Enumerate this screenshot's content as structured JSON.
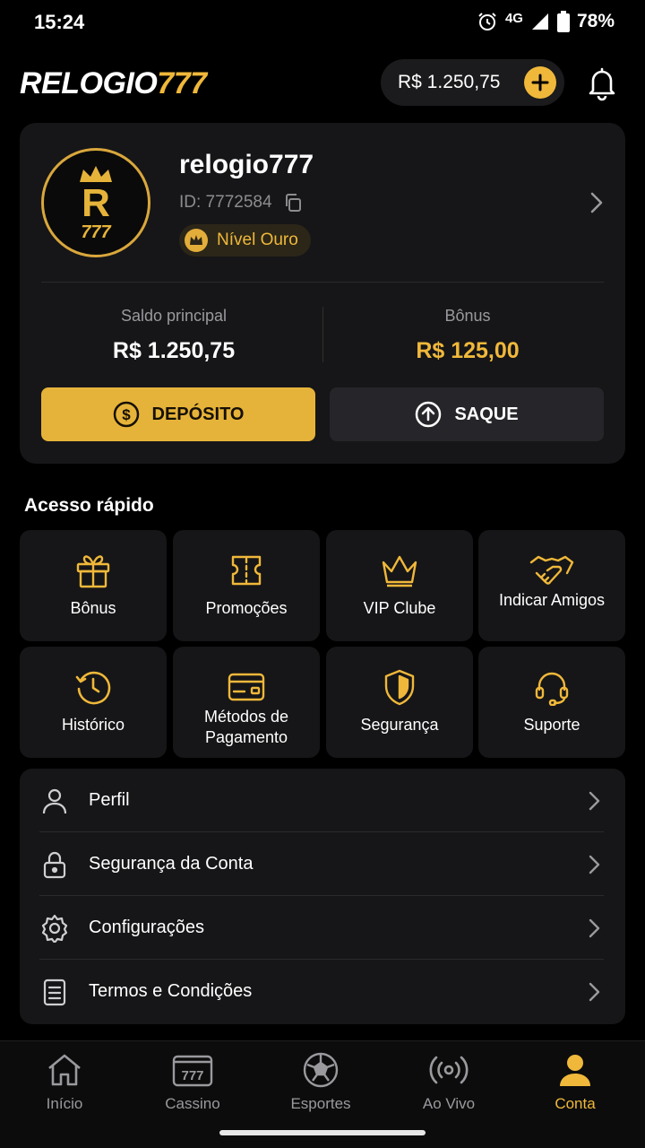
{
  "status_bar": {
    "time": "15:24",
    "network": "4G",
    "battery": "78%"
  },
  "header": {
    "logo_white": "RELOGIO",
    "logo_gold": "777",
    "balance": "R$ 1.250,75"
  },
  "profile": {
    "username": "relogio777",
    "user_id": "ID: 7772584",
    "level": "Nível Ouro",
    "avatar_letter": "R",
    "avatar_number": "777"
  },
  "wallet": {
    "main_label": "Saldo principal",
    "main_value": "R$ 1.250,75",
    "bonus_label": "Bônus",
    "bonus_value": "R$ 125,00",
    "deposit_label": "DEPÓSITO",
    "withdraw_label": "SAQUE"
  },
  "quick_access": {
    "title": "Acesso rápido",
    "tiles": [
      {
        "label": "Bônus",
        "icon": "gift-icon"
      },
      {
        "label": "Promoções",
        "icon": "ticket-icon"
      },
      {
        "label": "VIP Clube",
        "icon": "crown-icon"
      },
      {
        "label": "Indicar Amigos",
        "icon": "handshake-icon"
      },
      {
        "label": "Histórico",
        "icon": "history-icon"
      },
      {
        "label": "Métodos de Pagamento",
        "icon": "card-icon"
      },
      {
        "label": "Segurança",
        "icon": "shield-icon"
      },
      {
        "label": "Suporte",
        "icon": "headset-icon"
      }
    ]
  },
  "menu": [
    {
      "label": "Perfil",
      "icon": "user-icon"
    },
    {
      "label": "Segurança da Conta",
      "icon": "lock-icon"
    },
    {
      "label": "Configurações",
      "icon": "gear-icon"
    },
    {
      "label": "Termos e Condições",
      "icon": "document-icon"
    }
  ],
  "bottom_nav": [
    {
      "label": "Início",
      "icon": "home-icon"
    },
    {
      "label": "Cassino",
      "icon": "slot-icon"
    },
    {
      "label": "Esportes",
      "icon": "soccer-ball-icon"
    },
    {
      "label": "Ao Vivo",
      "icon": "live-icon"
    },
    {
      "label": "Conta",
      "icon": "account-icon",
      "active": true
    }
  ],
  "colors": {
    "accent": "#f0b83a",
    "background": "#000000",
    "surface": "#161618",
    "muted": "#9a9a9e"
  }
}
